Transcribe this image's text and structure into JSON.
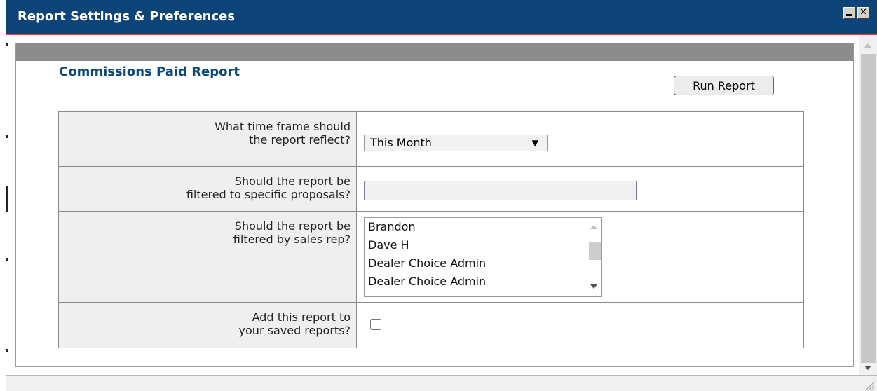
{
  "window": {
    "title": "Report Settings & Preferences",
    "minimize_icon": "minimize-icon",
    "close_icon": "close-icon",
    "title_bar_color": "#0c4379"
  },
  "report": {
    "title": "Commissions Paid Report",
    "run_button": "Run Report",
    "title_color": "#0c4a7d"
  },
  "form": {
    "time_frame": {
      "label": "What time frame should\nthe report reflect?",
      "selected": "This Month"
    },
    "proposals": {
      "label": "Should the report be\nfiltered to specific proposals?",
      "value": ""
    },
    "sales_rep": {
      "label": "Should the report be\nfiltered by sales rep?",
      "options": [
        "Brandon",
        "Dave H",
        "Dealer Choice Admin",
        "Dealer Choice Admin"
      ]
    },
    "save": {
      "label": "Add this report to\nyour saved reports?",
      "checked": false
    }
  }
}
